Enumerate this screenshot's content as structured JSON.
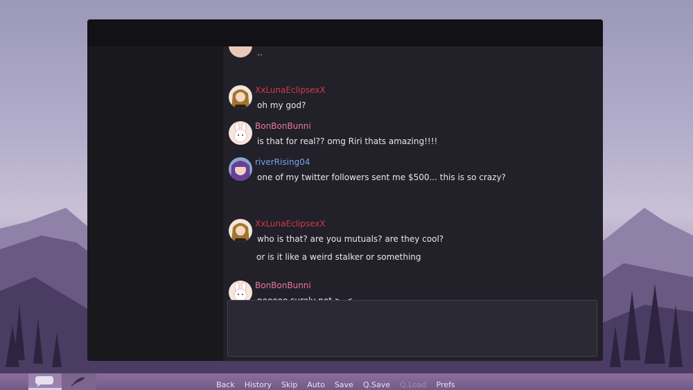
{
  "theme": {
    "name_colors": {
      "luna": "#d23a49",
      "bonbon": "#e878a6",
      "river": "#7aa0f0"
    },
    "text_color": "#e8e6ee"
  },
  "chat": {
    "partial_line": "..",
    "messages": [
      {
        "user": "XxLunaEclipsexX",
        "avatar": "luna-avatar",
        "lines": [
          "oh my god?"
        ]
      },
      {
        "user": "BonBonBunni",
        "avatar": "bunny-avatar",
        "lines": [
          "is that for real?? omg Riri thats amazing!!!!"
        ]
      },
      {
        "user": "riverRising04",
        "avatar": "river-avatar",
        "lines": [
          "one of my twitter followers sent me $500... this is so crazy?"
        ]
      },
      {
        "user": "XxLunaEclipsexX",
        "avatar": "luna-avatar",
        "lines": [
          "who is that? are you mutuals? are they cool?",
          "or is it like a weird stalker or something"
        ]
      },
      {
        "user": "BonBonBunni",
        "avatar": "bunny-avatar",
        "lines": [
          "nooooo surely not >_<"
        ]
      }
    ]
  },
  "quick_menu": {
    "tabs": [
      "chat-bubble-icon",
      "quill-icon"
    ],
    "items": [
      "Back",
      "History",
      "Skip",
      "Auto",
      "Save",
      "Q.Save",
      "Q.Load",
      "Prefs"
    ],
    "disabled_item": "Q.Load"
  }
}
